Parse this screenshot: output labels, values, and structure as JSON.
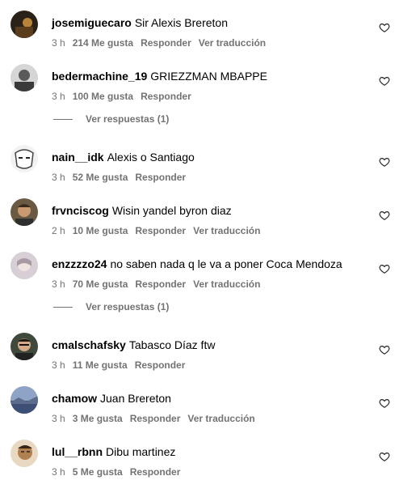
{
  "comments": [
    {
      "username": "josemiguecaro",
      "text": "Sir Alexis Brereton",
      "time": "3 h",
      "likes": "214 Me gusta",
      "reply_label": "Responder",
      "translate_label": "Ver traducción",
      "avatar_icon": "avatar-dark-icon",
      "avatar_color": "#2a2118"
    },
    {
      "username": "bedermachine_19",
      "text": "GRIEZZMAN MBAPPE",
      "time": "3 h",
      "likes": "100 Me gusta",
      "reply_label": "Responder",
      "translate_label": "",
      "avatar_icon": "avatar-grey-icon",
      "avatar_color": "#8a8a8a"
    },
    {
      "username": "nain__idk",
      "text": "Alexis o Santiago",
      "time": "3 h",
      "likes": "52 Me gusta",
      "reply_label": "Responder",
      "translate_label": "",
      "avatar_icon": "avatar-sketch-icon",
      "avatar_color": "#cfcfcf"
    },
    {
      "username": "frvnciscog",
      "text": "Wisin yandel byron diaz",
      "time": "2 h",
      "likes": "10 Me gusta",
      "reply_label": "Responder",
      "translate_label": "Ver traducción",
      "avatar_icon": "avatar-face-icon",
      "avatar_color": "#6b5a43"
    },
    {
      "username": "enzzzzo24",
      "text": "no saben nada q le va a poner Coca Mendoza",
      "time": "3 h",
      "likes": "70 Me gusta",
      "reply_label": "Responder",
      "translate_label": "Ver traducción",
      "avatar_icon": "avatar-pale-icon",
      "avatar_color": "#d8cfd6"
    },
    {
      "username": "cmalschafsky",
      "text": "Tabasco Díaz ftw",
      "time": "3 h",
      "likes": "11 Me gusta",
      "reply_label": "Responder",
      "translate_label": "",
      "avatar_icon": "avatar-face-icon",
      "avatar_color": "#3f4a3c"
    },
    {
      "username": "chamow",
      "text": "Juan Brereton",
      "time": "3 h",
      "likes": "3 Me gusta",
      "reply_label": "Responder",
      "translate_label": "Ver traducción",
      "avatar_icon": "avatar-landscape-icon",
      "avatar_color": "#5a6b8c"
    },
    {
      "username": "lul__rbnn",
      "text": "Dibu martinez",
      "time": "3 h",
      "likes": "5 Me gusta",
      "reply_label": "Responder",
      "translate_label": "",
      "avatar_icon": "avatar-face-icon",
      "avatar_color": "#b08050"
    }
  ],
  "view_replies": [
    "Ver respuestas (1)",
    "Ver respuestas (1)"
  ],
  "colors": {
    "secondary_text": "#737373",
    "primary_text": "#000000",
    "background": "#ffffff"
  },
  "icons": {
    "like": "heart-outline-icon"
  }
}
